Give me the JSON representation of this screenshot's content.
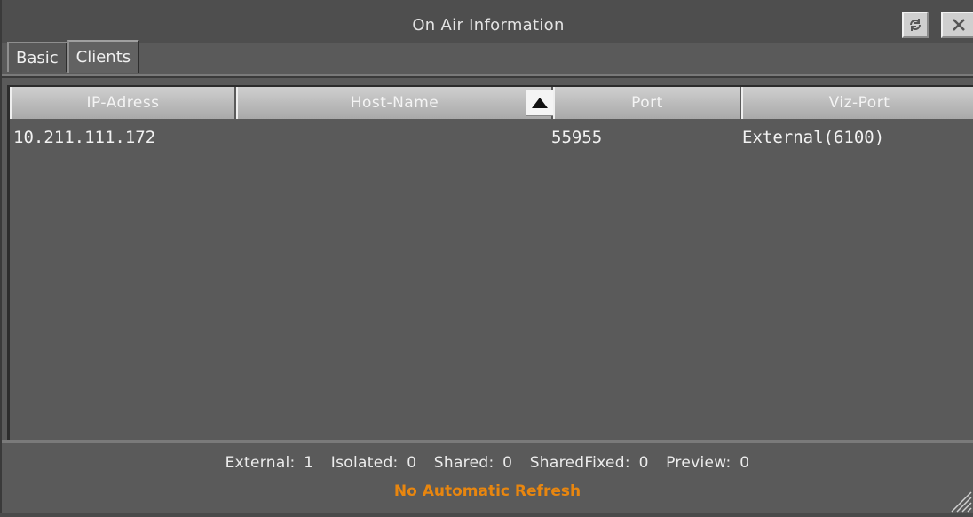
{
  "window": {
    "title": "On Air Information",
    "refresh_icon": "refresh-icon",
    "close_icon": "close-icon"
  },
  "tabs": [
    {
      "label": "Basic",
      "active": false
    },
    {
      "label": "Clients",
      "active": true
    }
  ],
  "table": {
    "columns": [
      {
        "label": "IP-Adress"
      },
      {
        "label": "Host-Name",
        "sort": "ascending"
      },
      {
        "label": "Port"
      },
      {
        "label": "Viz-Port"
      }
    ],
    "rows": [
      {
        "ip": "10.211.111.172",
        "host": "",
        "port": "55955",
        "viz_port": "External(6100)"
      }
    ]
  },
  "status": {
    "counts": "External: 1  Isolated: 0  Shared: 0  SharedFixed: 0  Preview: 0",
    "refresh_note": "No Automatic Refresh",
    "refresh_note_color": "#e8860f"
  }
}
